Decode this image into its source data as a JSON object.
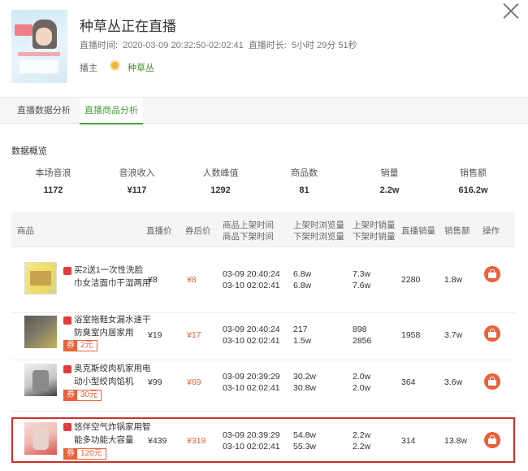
{
  "header": {
    "title": "种草丛正在直播",
    "time_label": "直播时间:",
    "time_value": "2020-03-09 20:32:50-02:02:41",
    "duration_label": "直播时长:",
    "duration_value": "5小时 29分 51秒",
    "anchor_label": "播主",
    "anchor_name": "种草丛",
    "close_icon": "close-icon"
  },
  "tabs": [
    {
      "label": "直播数据分析",
      "active": false
    },
    {
      "label": "直播商品分析",
      "active": true
    }
  ],
  "overview": {
    "title": "数据概览",
    "stats": [
      {
        "label": "本场音浪",
        "value": "1172"
      },
      {
        "label": "音浪收入",
        "value": "¥117"
      },
      {
        "label": "人数峰值",
        "value": "1292"
      },
      {
        "label": "商品数",
        "value": "81"
      },
      {
        "label": "销量",
        "value": "2.2w"
      },
      {
        "label": "销售额",
        "value": "616.2w"
      }
    ]
  },
  "table": {
    "headers": {
      "product": "商品",
      "live_price": "直播价",
      "coupon_price": "券后价",
      "shelf_time_1": "商品上架时间",
      "shelf_time_2": "商品下架时间",
      "views_1": "上架时浏览量",
      "views_2": "下架时浏览量",
      "sales_1": "上架时销量",
      "sales_2": "下架时销量",
      "live_sales": "直播销量",
      "revenue": "销售额",
      "action": "操作"
    },
    "rows": [
      {
        "name": "买2送1一次性洗脸巾女洁面巾干湿两用",
        "coupon": null,
        "price": "¥8",
        "after": "¥8",
        "t_on": "03-09 20:40:24",
        "t_off": "03-10 02:02:41",
        "v_on": "6.8w",
        "v_off": "6.8w",
        "s_on": "7.3w",
        "s_off": "7.6w",
        "live_sales": "2280",
        "revenue": "1.8w",
        "highlight": false
      },
      {
        "name": "浴室拖鞋女漏水速干防臭室内居家用",
        "coupon": {
          "tag": "券",
          "amount": "2元"
        },
        "price": "¥19",
        "after": "¥17",
        "t_on": "03-09 20:40:24",
        "t_off": "03-10 02:02:41",
        "v_on": "217",
        "v_off": "1.5w",
        "s_on": "898",
        "s_off": "2856",
        "live_sales": "1958",
        "revenue": "3.7w",
        "highlight": false
      },
      {
        "name": "奥克斯绞肉机家用电动小型绞肉馅机",
        "coupon": {
          "tag": "券",
          "amount": "30元"
        },
        "price": "¥99",
        "after": "¥69",
        "t_on": "03-09 20:39:29",
        "t_off": "03-10 02:02:41",
        "v_on": "30.2w",
        "v_off": "30.8w",
        "s_on": "2.0w",
        "s_off": "2.0w",
        "live_sales": "364",
        "revenue": "3.6w",
        "highlight": false
      },
      {
        "name": "悠伴空气炸锅家用智能多功能大容量",
        "coupon": {
          "tag": "券",
          "amount": "120元"
        },
        "price": "¥439",
        "after": "¥319",
        "t_on": "03-09 20:39:29",
        "t_off": "03-10 02:02:41",
        "v_on": "54.8w",
        "v_off": "55.3w",
        "s_on": "2.2w",
        "s_off": "2.2w",
        "live_sales": "314",
        "revenue": "13.8w",
        "highlight": true
      }
    ]
  },
  "colors": {
    "accent": "#48a13a",
    "price": "#e9623a",
    "highlight_border": "#c9302c"
  }
}
